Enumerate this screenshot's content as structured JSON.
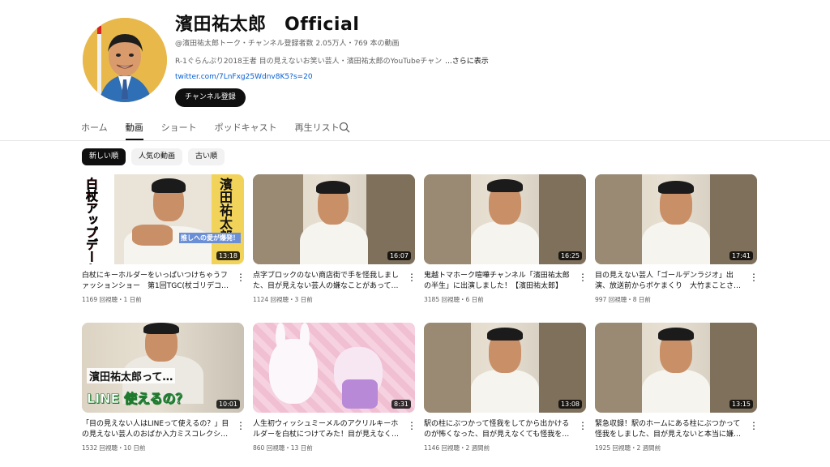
{
  "channel": {
    "title": "濱田祐太郎　Official",
    "meta": "@濱田祐太郎トーク・チャンネル登録者数 2.05万人・769 本の動画",
    "description": "R-1ぐらんぷり2018王者 目の見えないお笑い芸人・濱田祐太郎のYouTubeチャン",
    "more_label": "...さらに表示",
    "link": "twitter.com/7LnFxg25Wdnv8K5?s=20",
    "subscribe_label": "チャンネル登録"
  },
  "tabs": [
    {
      "label": "ホーム"
    },
    {
      "label": "動画",
      "active": true
    },
    {
      "label": "ショート"
    },
    {
      "label": "ポッドキャスト"
    },
    {
      "label": "再生リスト"
    }
  ],
  "chips": [
    {
      "label": "新しい順",
      "active": true
    },
    {
      "label": "人気の動画"
    },
    {
      "label": "古い順"
    }
  ],
  "videos": [
    {
      "title": "白杖にキーホルダーをいっぱいつけちゃうファッションショー　第1回TGC(杖ゴリデコ…",
      "duration": "13:18",
      "meta": "1169 回視聴・1 日前",
      "overlay": {
        "left": "白杖アップデート",
        "right": "濱田祐太郎",
        "mid": "推しへの愛が爆発！"
      }
    },
    {
      "title": "点字ブロックのない商店街で手を怪我しました、目が見えない芸人の嫌なことがあって…",
      "duration": "16:07",
      "meta": "1124 回視聴・3 日前"
    },
    {
      "title": "鬼越トマホーク喧嘩チャンネル「濱田祐太郎の半生」に出演しました！【濱田祐太郎】",
      "duration": "16:25",
      "meta": "3185 回視聴・6 日前"
    },
    {
      "title": "目の見えない芸人「ゴールデンラジオ」出演、放送前からボケまくり　大竹まことさ…",
      "duration": "17:41",
      "meta": "997 回視聴・8 日前"
    },
    {
      "title": "「目の見えない人はLINEって使えるの？」目の見えない芸人のおばか入力ミスコレクシ…",
      "duration": "10:01",
      "meta": "1532 回視聴・10 日前",
      "overlay": {
        "top": "濱田祐太郎って…",
        "bottom": "LINE 使えるの？"
      }
    },
    {
      "title": "人生初ウィッシュミーメルのアクリルキーホルダーを白杖につけてみた！目が見えなく…",
      "duration": "8:31",
      "meta": "860 回視聴・13 日前"
    },
    {
      "title": "駅の柱にぶつかって怪我をしてから出かけるのが怖くなった、目が見えなくても怪我を…",
      "duration": "13:08",
      "meta": "1146 回視聴・2 週間前"
    },
    {
      "title": "緊急収録！駅のホームにある柱にぶつかって怪我をしました、目が見えないと本当に嫌…",
      "duration": "13:15",
      "meta": "1925 回視聴・2 週間前"
    }
  ]
}
